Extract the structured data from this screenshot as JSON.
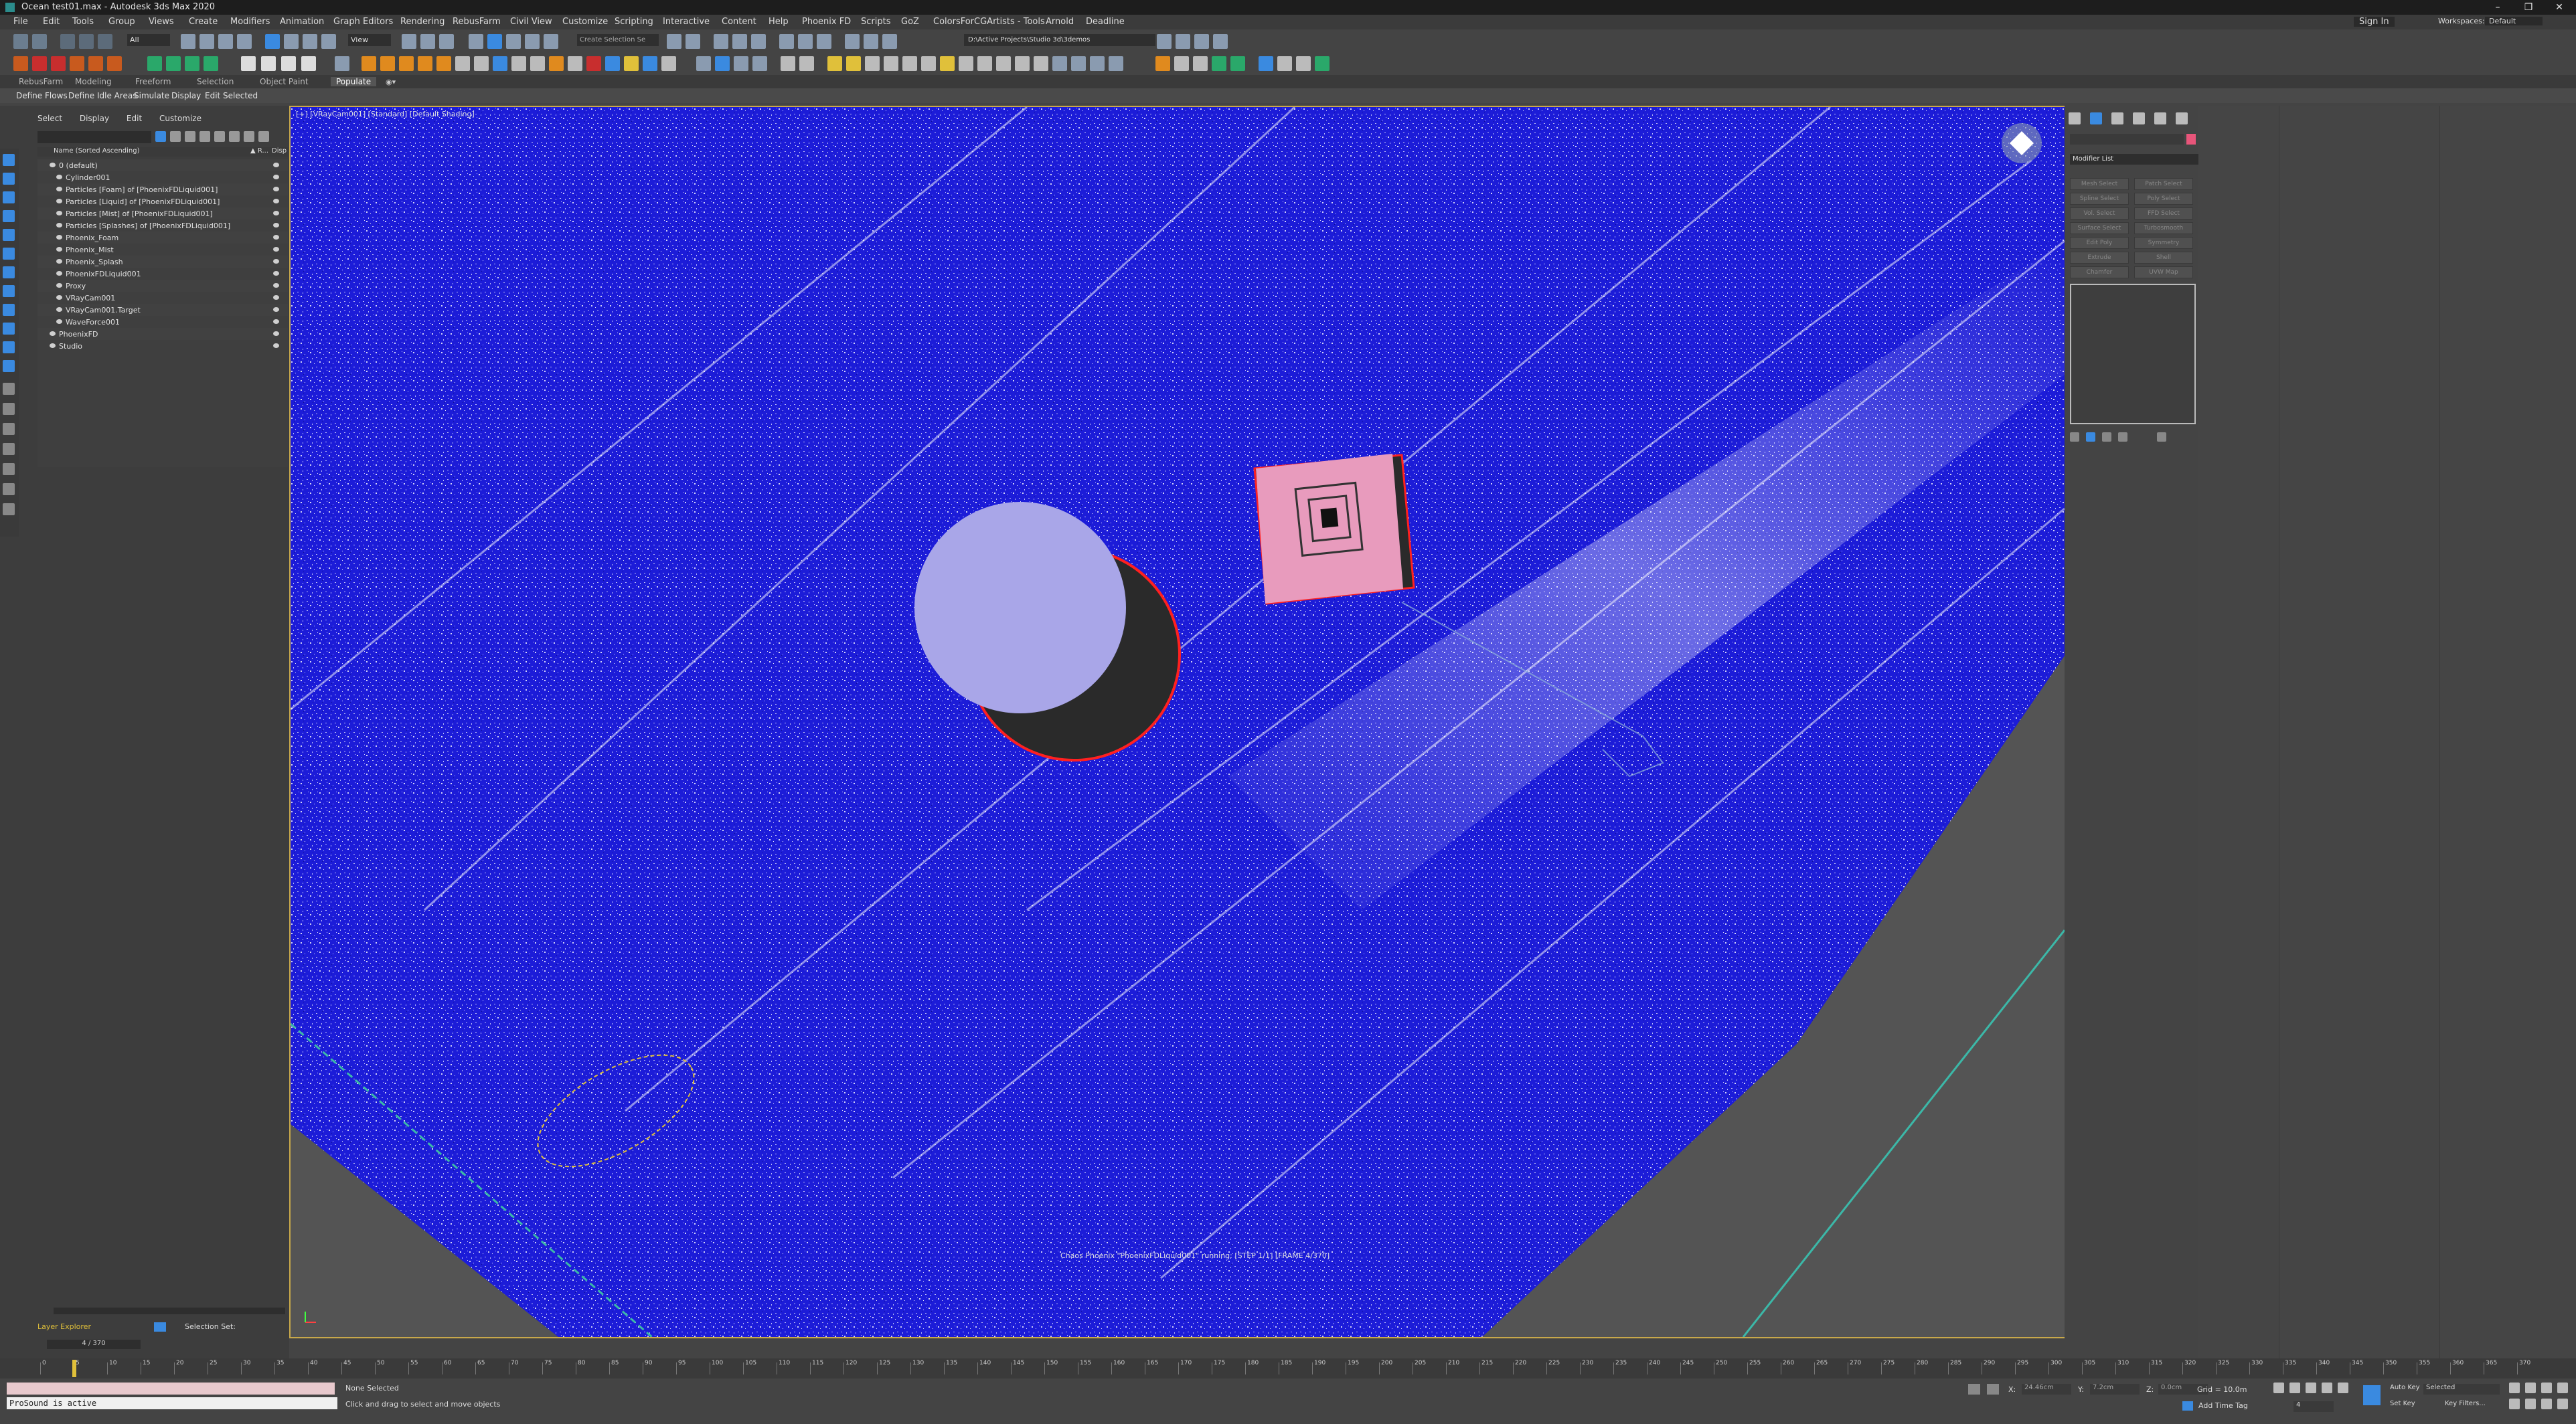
{
  "window": {
    "title": "Ocean test01.max - Autodesk 3ds Max 2020",
    "controls": [
      "–",
      "❐",
      "✕"
    ]
  },
  "menu": [
    "File",
    "Edit",
    "Tools",
    "Group",
    "Views",
    "Create",
    "Modifiers",
    "Animation",
    "Graph Editors",
    "Rendering",
    "RebusFarm",
    "Civil View",
    "Customize",
    "Scripting",
    "Interactive",
    "Content",
    "Help",
    "Phoenix FD",
    "Scripts",
    "GoZ",
    "ColorsForCGArtists - Tools",
    "Arnold",
    "Deadline"
  ],
  "account": {
    "sign_in": "Sign In",
    "workspaces_label": "Workspaces:",
    "workspace_value": "Default"
  },
  "toolbar": {
    "filter_value": "All",
    "view_value": "View",
    "selection_set_placeholder": "Create Selection Se",
    "project_path": "D:\\Active Projects\\Studio 3d\\3demos"
  },
  "ribbon": {
    "tabs": [
      "RebusFarm",
      "Modeling",
      "Freeform",
      "Selection",
      "Object Paint",
      "Populate"
    ],
    "commands": [
      "Define Flows",
      "Define Idle Areas",
      "Simulate",
      "Display",
      "Edit Selected"
    ]
  },
  "scene_explorer": {
    "menu": [
      "Select",
      "Display",
      "Edit",
      "Customize"
    ],
    "col_name": "Name (Sorted Ascending)",
    "col_r": "▲ R...",
    "col_disp": "Disp",
    "items": [
      {
        "label": "0 (default)",
        "indent": 0
      },
      {
        "label": "Cylinder001",
        "indent": 1
      },
      {
        "label": "Particles [Foam] of [PhoenixFDLiquid001]",
        "indent": 1
      },
      {
        "label": "Particles [Liquid] of [PhoenixFDLiquid001]",
        "indent": 1
      },
      {
        "label": "Particles [Mist] of [PhoenixFDLiquid001]",
        "indent": 1
      },
      {
        "label": "Particles [Splashes] of [PhoenixFDLiquid001]",
        "indent": 1
      },
      {
        "label": "Phoenix_Foam",
        "indent": 1
      },
      {
        "label": "Phoenix_Mist",
        "indent": 1
      },
      {
        "label": "Phoenix_Splash",
        "indent": 1
      },
      {
        "label": "PhoenixFDLiquid001",
        "indent": 1
      },
      {
        "label": "Proxy",
        "indent": 1
      },
      {
        "label": "VRayCam001",
        "indent": 1
      },
      {
        "label": "VRayCam001.Target",
        "indent": 1
      },
      {
        "label": "WaveForce001",
        "indent": 1
      },
      {
        "label": "PhoenixFD",
        "indent": 0
      },
      {
        "label": "Studio",
        "indent": 0
      }
    ],
    "layer_explorer": "Layer Explorer",
    "selection_set": "Selection Set:"
  },
  "viewport": {
    "label": "[+] [VRayCam001] [Standard] [Default Shading]",
    "status_text": "Chaos Phoenix \"PhoenixFDLiquid001\" running: [STEP 1/1] [FRAME 4/370]",
    "colors": {
      "water": "#1c1cd8",
      "particles": "#ffffff",
      "cylinder": "#a9a6e8",
      "box": "#e89bbd",
      "selection": "#ff2020"
    }
  },
  "command_panel": {
    "modifier_list": "Modifier List",
    "buttons": [
      "Mesh Select",
      "Patch Select",
      "Spline Select",
      "Poly Select",
      "Vol. Select",
      "FFD Select",
      "Surface Select",
      "Turbosmooth",
      "Edit Poly",
      "Symmetry",
      "Extrude",
      "Shell",
      "Chamfer",
      "UVW Map"
    ]
  },
  "timeline": {
    "frame": "4 / 370",
    "ticks": [
      "0",
      "5",
      "10",
      "15",
      "20",
      "25",
      "30",
      "35",
      "40",
      "45",
      "50",
      "55",
      "60",
      "65",
      "70",
      "75",
      "80",
      "85",
      "90",
      "95",
      "100",
      "105",
      "110",
      "115",
      "120",
      "125",
      "130",
      "135",
      "140",
      "145",
      "150",
      "155",
      "160",
      "165",
      "170",
      "175",
      "180",
      "185",
      "190",
      "195",
      "200",
      "205",
      "210",
      "215",
      "220",
      "225",
      "230",
      "235",
      "240",
      "245",
      "250",
      "255",
      "260",
      "265",
      "270",
      "275",
      "280",
      "285",
      "290",
      "295",
      "300",
      "305",
      "310",
      "315",
      "320",
      "325",
      "330",
      "335",
      "340",
      "345",
      "350",
      "355",
      "360",
      "365",
      "370"
    ]
  },
  "status_bar": {
    "maxscript": "ProSound is active",
    "selection": "None Selected",
    "prompt": "Click and drag to select and move objects",
    "x_label": "X:",
    "x_val": "24.46cm",
    "y_label": "Y:",
    "y_val": "7.2cm",
    "z_label": "Z:",
    "z_val": "0.0cm",
    "grid": "Grid = 10.0m",
    "add_time_tag": "Add Time Tag",
    "auto_key": "Auto Key",
    "set_key": "Set Key",
    "selected_value": "Selected",
    "key_filters": "Key Filters...",
    "frame_value": "4"
  }
}
